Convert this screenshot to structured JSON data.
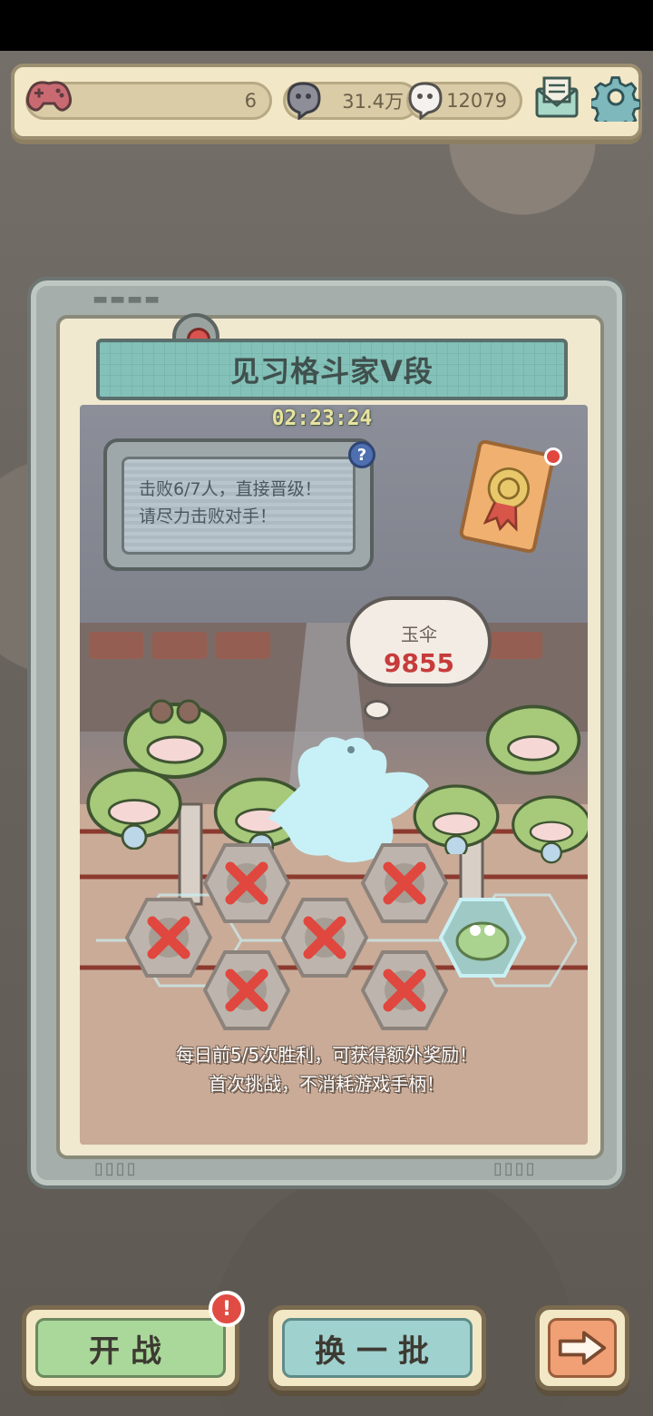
{
  "top_bar": {
    "gamepads": "6",
    "coins": "31.4万",
    "souls": "12079"
  },
  "arena": {
    "rank_title": "见习格斗家V段",
    "timer": "02:23:24",
    "hint_line1": "击败6/7人，直接晋级！",
    "hint_line2": "请尽力击败对手！",
    "help": "?",
    "opponent": {
      "name": "玉伞",
      "score": "9855"
    },
    "opponents_total": 7,
    "opponents_defeated": 6
  },
  "footer": {
    "line1": "每日前5/5次胜利，可获得额外奖励！",
    "line2": "首次挑战，不消耗游戏手柄！"
  },
  "buttons": {
    "fight": "开战",
    "refresh": "换一批",
    "badge": "!"
  },
  "colors": {
    "accent_red": "#c73b3b",
    "banner": "#b7ded9",
    "fight_green": "#a9d89a",
    "refresh_teal": "#9fd1cf",
    "next_orange": "#f0a074"
  }
}
